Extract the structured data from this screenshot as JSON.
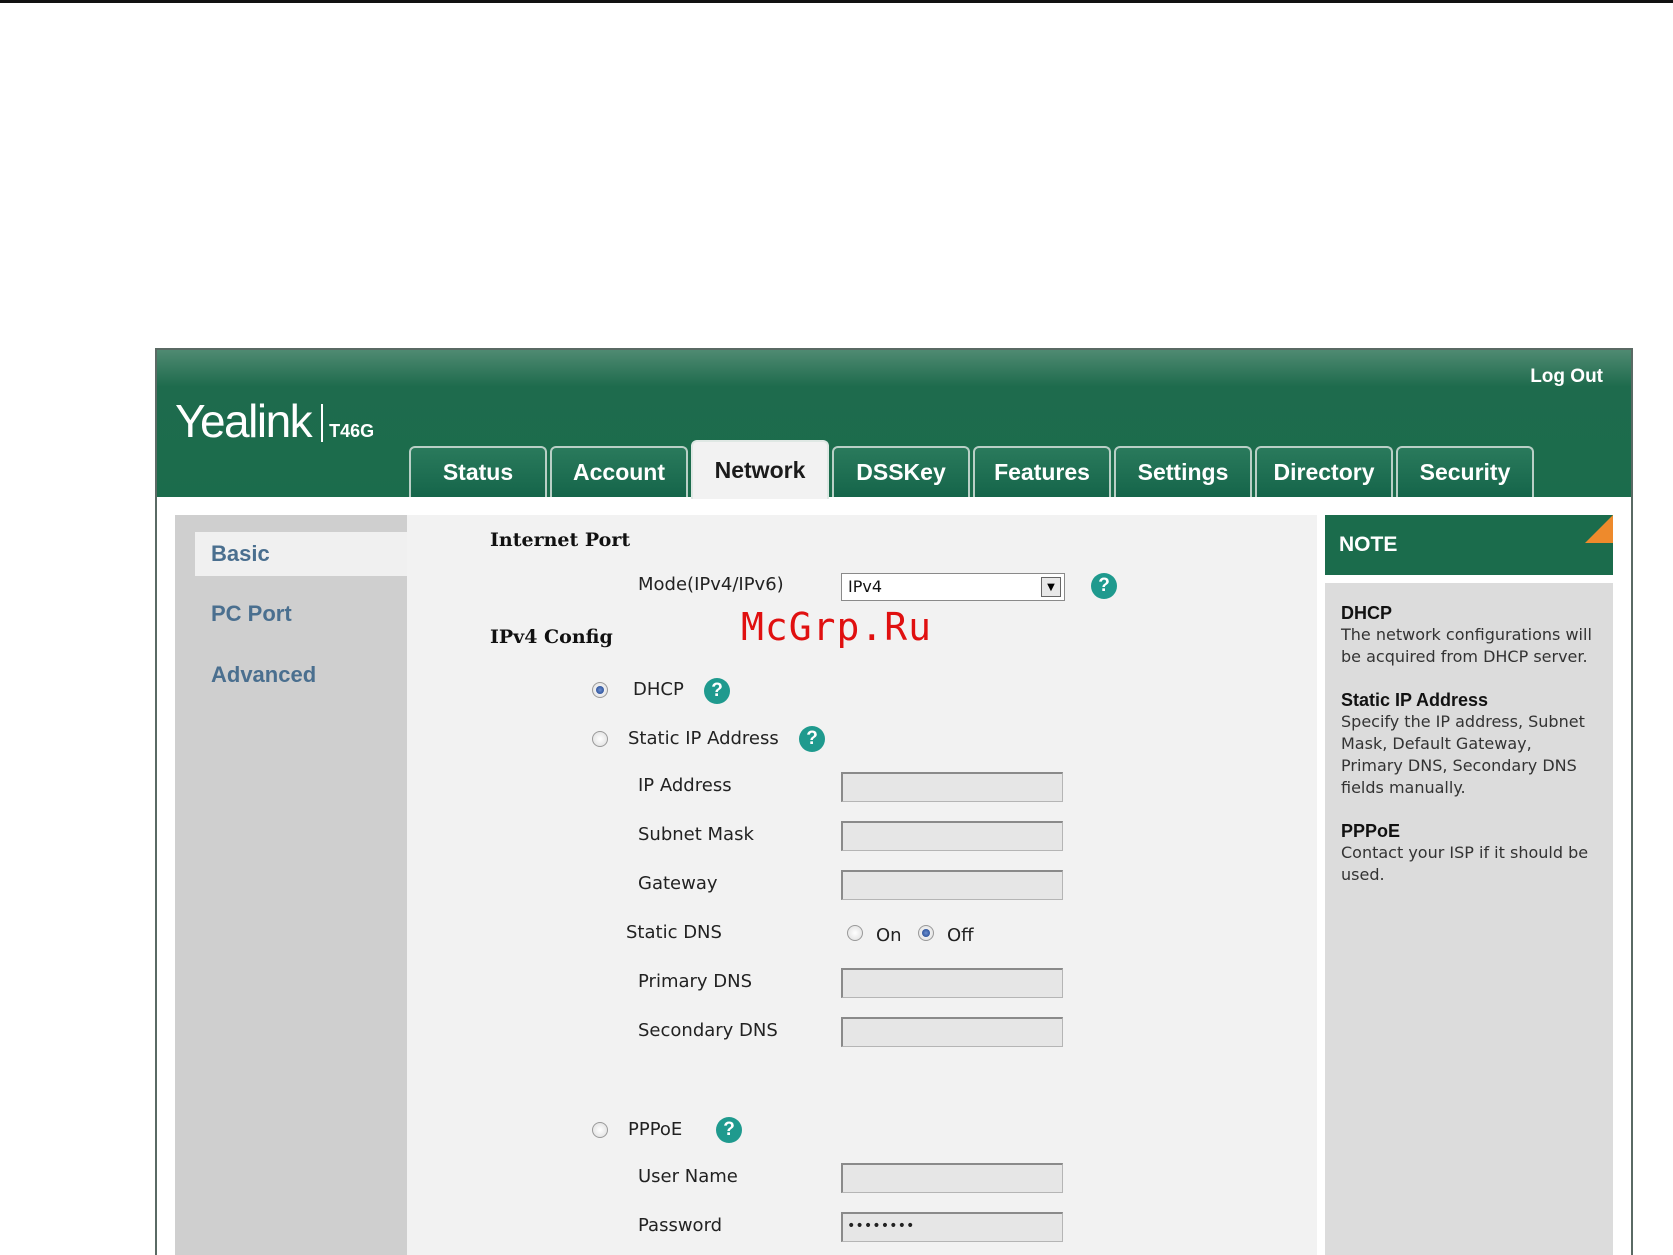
{
  "header": {
    "logout_label": "Log Out",
    "logo_text": "Yealink",
    "model": "T46G"
  },
  "tabs": [
    {
      "label": "Status"
    },
    {
      "label": "Account"
    },
    {
      "label": "Network",
      "active": true
    },
    {
      "label": "DSSKey"
    },
    {
      "label": "Features"
    },
    {
      "label": "Settings"
    },
    {
      "label": "Directory"
    },
    {
      "label": "Security"
    }
  ],
  "sidebar": {
    "items": [
      {
        "label": "Basic",
        "active": true
      },
      {
        "label": "PC Port"
      },
      {
        "label": "Advanced"
      }
    ]
  },
  "main": {
    "internet_port_title": "Internet Port",
    "mode_label": "Mode(IPv4/IPv6)",
    "mode_value": "IPv4",
    "ipv4_title": "IPv4 Config",
    "dhcp_label": "DHCP",
    "static_ip_label": "Static IP Address",
    "ip_address_label": "IP Address",
    "subnet_mask_label": "Subnet Mask",
    "gateway_label": "Gateway",
    "static_dns_label": "Static DNS",
    "on_label": "On",
    "off_label": "Off",
    "primary_dns_label": "Primary DNS",
    "secondary_dns_label": "Secondary DNS",
    "pppoe_label": "PPPoE",
    "user_name_label": "User Name",
    "password_label": "Password",
    "password_value": "••••••••",
    "help_glyph": "?",
    "selected_ip_mode": "DHCP",
    "static_dns_selected": "Off"
  },
  "note": {
    "title": "NOTE",
    "sections": [
      {
        "title": "DHCP",
        "text": "The network configurations will be acquired from DHCP server."
      },
      {
        "title": "Static IP Address",
        "text": "Specify the IP address, Subnet Mask, Default Gateway, Primary DNS, Secondary DNS fields manually."
      },
      {
        "title": "PPPoE",
        "text": "Contact your ISP if it should be used."
      }
    ]
  },
  "watermark": "McGrp.Ru",
  "colors": {
    "header_green": "#1b6c4c",
    "note_accent": "#ee8a2c",
    "help_teal": "#1f9a8e",
    "sidebar_link": "#4a6f8f",
    "watermark_red": "#e01010"
  }
}
